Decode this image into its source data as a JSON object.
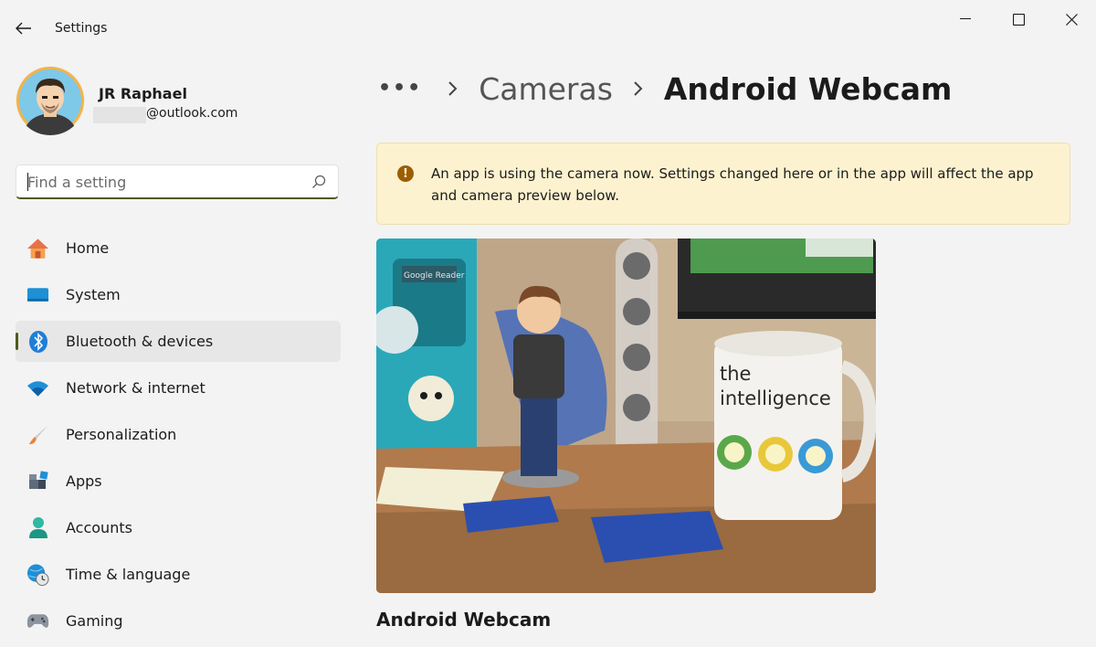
{
  "window": {
    "title": "Settings"
  },
  "profile": {
    "name": "JR Raphael",
    "email": "@outlook.com"
  },
  "search": {
    "placeholder": "Find a setting"
  },
  "nav": {
    "items": [
      {
        "label": "Home",
        "icon": "home-icon"
      },
      {
        "label": "System",
        "icon": "monitor-icon"
      },
      {
        "label": "Bluetooth & devices",
        "icon": "bluetooth-icon",
        "active": true
      },
      {
        "label": "Network & internet",
        "icon": "wifi-icon"
      },
      {
        "label": "Personalization",
        "icon": "paintbrush-icon"
      },
      {
        "label": "Apps",
        "icon": "apps-icon"
      },
      {
        "label": "Accounts",
        "icon": "person-icon"
      },
      {
        "label": "Time & language",
        "icon": "globe-clock-icon"
      },
      {
        "label": "Gaming",
        "icon": "gamepad-icon"
      }
    ]
  },
  "breadcrumb": {
    "more": "•••",
    "parent": "Cameras",
    "current": "Android Webcam"
  },
  "banner": {
    "icon": "warning-icon",
    "text": "An app is using the camera now. Settings changed here or in the app will affect the app and camera preview below."
  },
  "preview": {
    "mug_text_line1": "the",
    "mug_text_line2": "intelligence",
    "sticker_text": "Google Reader"
  },
  "camera": {
    "name": "Android Webcam"
  },
  "colors": {
    "accent": "#4f5a1c",
    "banner_bg": "#fcf2cf",
    "warning": "#9d5d00",
    "background": "#f3f3f3"
  }
}
